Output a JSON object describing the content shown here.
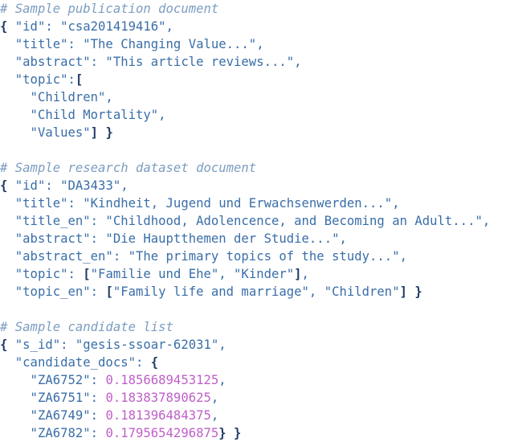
{
  "document": {
    "kind": "json-code-listing",
    "background_color": "#ffffff",
    "colors": {
      "comment": "#7c9dc0",
      "key_and_string": "#3a6ea8",
      "brace_bracket": "#1f3a63",
      "number": "#bf5fc8"
    }
  },
  "blocks": [
    {
      "id": "publication-document",
      "comment": "# Sample publication document",
      "lines": [
        [
          {
            "t": "brace",
            "v": "{"
          },
          {
            "t": "key",
            "v": " \"id\": \"csa201419416\","
          }
        ],
        [
          {
            "t": "key",
            "v": "  \"title\": \"The Changing Value...\","
          }
        ],
        [
          {
            "t": "key",
            "v": "  \"abstract\": \"This article reviews...\","
          }
        ],
        [
          {
            "t": "key",
            "v": "  \"topic\":"
          },
          {
            "t": "brace",
            "v": "["
          }
        ],
        [
          {
            "t": "key",
            "v": "    \"Children\","
          }
        ],
        [
          {
            "t": "key",
            "v": "    \"Child Mortality\","
          }
        ],
        [
          {
            "t": "key",
            "v": "    \"Values\""
          },
          {
            "t": "brace",
            "v": "]"
          },
          {
            "t": "key",
            "v": " "
          },
          {
            "t": "brace",
            "v": "}"
          }
        ]
      ]
    },
    {
      "id": "research-dataset-document",
      "comment": "# Sample research dataset document",
      "lines": [
        [
          {
            "t": "brace",
            "v": "{"
          },
          {
            "t": "key",
            "v": " \"id\": \"DA3433\","
          }
        ],
        [
          {
            "t": "key",
            "v": "  \"title\": \"Kindheit, Jugend und Erwachsenwerden...\","
          }
        ],
        [
          {
            "t": "key",
            "v": "  \"title_en\": \"Childhood, Adolencence, and Becoming an Adult...\","
          }
        ],
        [
          {
            "t": "key",
            "v": "  \"abstract\": \"Die Hauptthemen der Studie...\","
          }
        ],
        [
          {
            "t": "key",
            "v": "  \"abstract_en\": \"The primary topics of the study...\","
          }
        ],
        [
          {
            "t": "key",
            "v": "  \"topic\": "
          },
          {
            "t": "brace",
            "v": "["
          },
          {
            "t": "key",
            "v": "\"Familie und Ehe\", \"Kinder\""
          },
          {
            "t": "brace",
            "v": "]"
          },
          {
            "t": "key",
            "v": ","
          }
        ],
        [
          {
            "t": "key",
            "v": "  \"topic_en\": "
          },
          {
            "t": "brace",
            "v": "["
          },
          {
            "t": "key",
            "v": "\"Family life and marriage\", \"Children\""
          },
          {
            "t": "brace",
            "v": "]"
          },
          {
            "t": "key",
            "v": " "
          },
          {
            "t": "brace",
            "v": "}"
          }
        ]
      ]
    },
    {
      "id": "candidate-list",
      "comment": "# Sample candidate list",
      "lines": [
        [
          {
            "t": "brace",
            "v": "{"
          },
          {
            "t": "key",
            "v": " \"s_id\": \"gesis-ssoar-62031\","
          }
        ],
        [
          {
            "t": "key",
            "v": "  \"candidate_docs\": "
          },
          {
            "t": "brace",
            "v": "{"
          }
        ],
        [
          {
            "t": "key",
            "v": "    \"ZA6752\": "
          },
          {
            "t": "number",
            "v": "0.1856689453125"
          },
          {
            "t": "key",
            "v": ","
          }
        ],
        [
          {
            "t": "key",
            "v": "    \"ZA6751\": "
          },
          {
            "t": "number",
            "v": "0.183837890625"
          },
          {
            "t": "key",
            "v": ","
          }
        ],
        [
          {
            "t": "key",
            "v": "    \"ZA6749\": "
          },
          {
            "t": "number",
            "v": "0.181396484375"
          },
          {
            "t": "key",
            "v": ","
          }
        ],
        [
          {
            "t": "key",
            "v": "    \"ZA6782\": "
          },
          {
            "t": "number",
            "v": "0.1795654296875"
          },
          {
            "t": "brace",
            "v": "}"
          },
          {
            "t": "key",
            "v": " "
          },
          {
            "t": "brace",
            "v": "}"
          }
        ]
      ]
    }
  ]
}
